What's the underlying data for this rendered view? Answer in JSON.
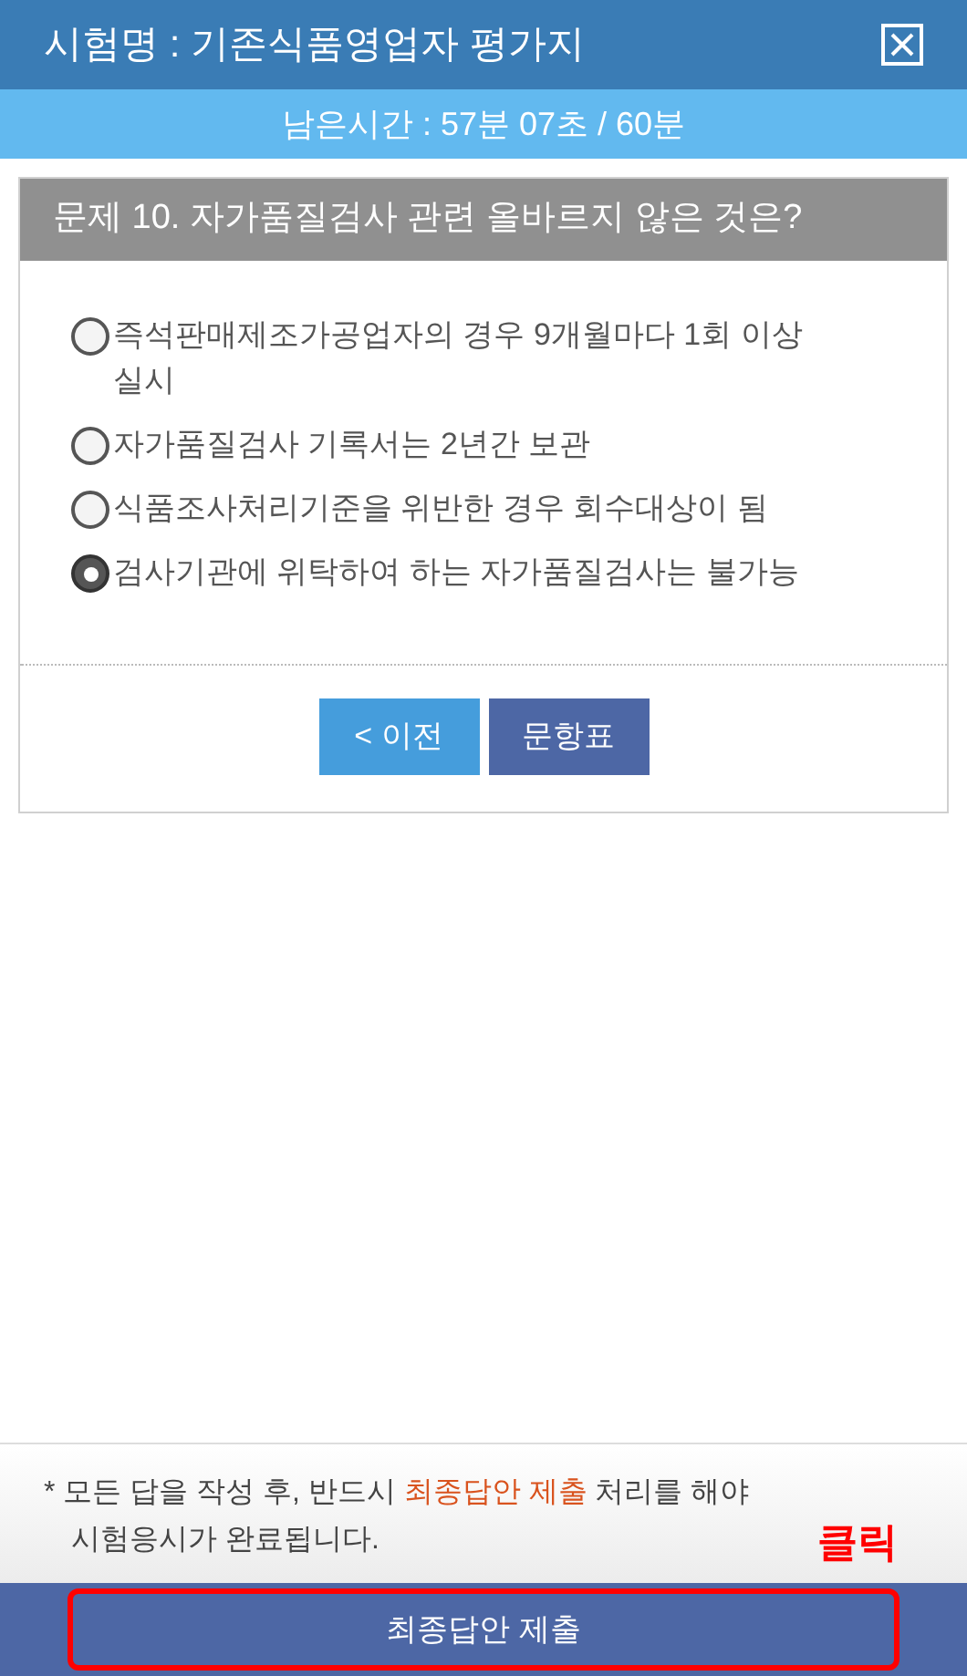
{
  "header": {
    "title": "시험명 : 기존식품영업자 평가지"
  },
  "timer": {
    "text": "남은시간 : 57분 07초 / 60분"
  },
  "question": {
    "title": "문제 10. 자가품질검사 관련 올바르지 않은 것은?",
    "options": [
      {
        "text": "즉석판매제조가공업자의 경우 9개월마다 1회 이상 실시",
        "selected": false
      },
      {
        "text": "자가품질검사 기록서는 2년간 보관",
        "selected": false
      },
      {
        "text": "식품조사처리기준을 위반한 경우 회수대상이 됨",
        "selected": false
      },
      {
        "text": "검사기관에 위탁하여 하는 자가품질검사는 불가능",
        "selected": true
      }
    ]
  },
  "nav_buttons": [
    {
      "kind": "prev",
      "label": "< 이전"
    },
    {
      "kind": "list",
      "label": "문항표"
    }
  ],
  "notice": "* 모든 답을 작성 후, 반드시 **최종답안 제출** 처리를 해야 시험응시가 완료됩니다.",
  "annotation": {
    "text": "클릭"
  },
  "submit_button": {
    "label": "최종답안 제출"
  }
}
